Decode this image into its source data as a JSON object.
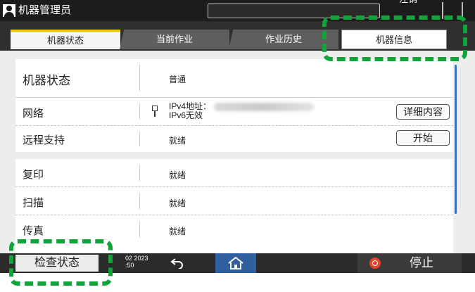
{
  "header": {
    "admin_label": "机器管理员",
    "logout_label": "注销"
  },
  "tabs": [
    {
      "label": "机器状态",
      "active": true
    },
    {
      "label": "当前作业",
      "active": false
    },
    {
      "label": "作业历史",
      "active": false
    },
    {
      "label": "机器信息",
      "active": false
    }
  ],
  "status_section": {
    "machine_status": {
      "label": "机器状态",
      "value": "普通"
    },
    "network": {
      "label": "网络",
      "ipv4_label": "IPv4地址：",
      "ipv6_label": "IPv6无效",
      "detail_button": "详细内容"
    },
    "remote_support": {
      "label": "远程支持",
      "value": "就绪",
      "start_button": "开始"
    }
  },
  "function_section": {
    "items": [
      {
        "label": "复印",
        "value": "就绪"
      },
      {
        "label": "扫描",
        "value": "就绪"
      },
      {
        "label": "传真",
        "value": "就绪"
      }
    ]
  },
  "bottom_bar": {
    "check_status_button": "检查状态",
    "date_text": "02 2023",
    "time_text": ":50",
    "stop_label": "停止"
  },
  "icons": {
    "user": "user-icon",
    "network": "ethernet-plug-icon",
    "back": "back-arrow-icon",
    "home": "home-icon",
    "stop": "stop-icon"
  },
  "colors": {
    "active_tab_accent": "#f2c400",
    "home_button": "#2f5f9f",
    "stop_icon": "#e0462d",
    "callout": "#13a33b",
    "scrollbar": "#3a6fbf"
  }
}
